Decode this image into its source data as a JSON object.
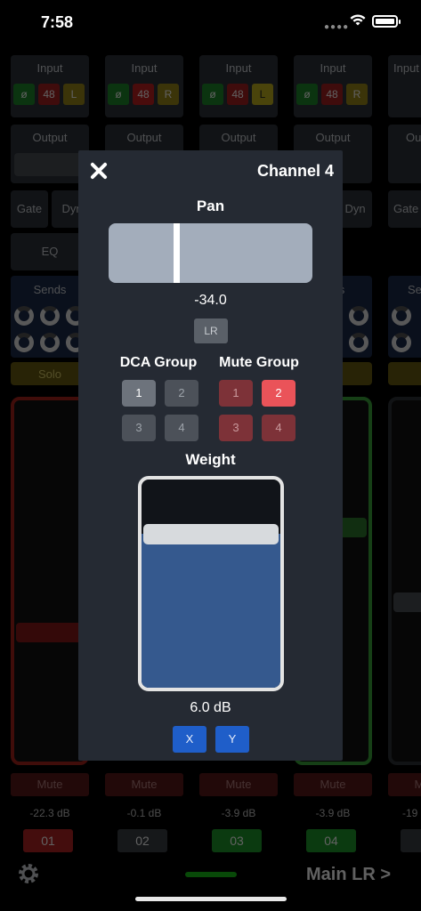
{
  "status_bar": {
    "time": "7:58"
  },
  "mixer": {
    "strips": [
      {
        "input_label": "Input",
        "chip_phase": "ø",
        "chip_48": "48",
        "chip_side": "L",
        "output_label": "Output",
        "gate_label": "Gate",
        "dyn_label": "Dyn",
        "eq_label": "EQ",
        "sends_label": "Sends",
        "solo_label": "Solo",
        "mute_label": "Mute",
        "level": "-22.3 dB",
        "number": "01",
        "number_color": "#b32222"
      },
      {
        "input_label": "Input",
        "chip_phase": "ø",
        "chip_48": "48",
        "chip_side": "R",
        "output_label": "Output",
        "gate_label": "",
        "dyn_label": "",
        "eq_label": "",
        "sends_label": "",
        "solo_label": "",
        "mute_label": "Mute",
        "level": "-0.1 dB",
        "number": "02",
        "number_color": "#3a3f46"
      },
      {
        "input_label": "Input",
        "chip_phase": "ø",
        "chip_48": "48",
        "chip_side": "L",
        "output_label": "Output",
        "gate_label": "",
        "dyn_label": "",
        "eq_label": "",
        "sends_label": "",
        "solo_label": "",
        "mute_label": "Mute",
        "level": "-3.9 dB",
        "number": "03",
        "number_color": "#1f9a2a"
      },
      {
        "input_label": "Input",
        "chip_phase": "ø",
        "chip_48": "48",
        "chip_side": "R",
        "output_label": "Output",
        "gate_label": "",
        "dyn_label": "Dyn",
        "eq_label": "",
        "sends_label": "s",
        "solo_label": "",
        "mute_label": "Mute",
        "level": "-3.9 dB",
        "number": "04",
        "number_color": "#1f9a2a"
      },
      {
        "input_label": "Input",
        "chip_phase": "",
        "chip_48": "",
        "chip_side": "",
        "output_label": "Ou",
        "gate_label": "Gate",
        "dyn_label": "",
        "eq_label": "",
        "sends_label": "Se",
        "solo_label": "",
        "mute_label": "Mute",
        "level": "-19",
        "number": "",
        "number_color": "#3a3f46"
      }
    ],
    "bottom_right_label": "Main LR >"
  },
  "modal": {
    "title": "Channel 4",
    "pan": {
      "title": "Pan",
      "value_text": "-34.0",
      "position_fraction": 0.33,
      "lr_label": "LR"
    },
    "dca_group": {
      "title": "DCA Group",
      "buttons": [
        "1",
        "2",
        "3",
        "4"
      ],
      "active": [
        true,
        false,
        false,
        false
      ]
    },
    "mute_group": {
      "title": "Mute Group",
      "buttons": [
        "1",
        "2",
        "3",
        "4"
      ],
      "active": [
        false,
        true,
        false,
        false
      ]
    },
    "weight": {
      "title": "Weight",
      "value_text": "6.0 dB",
      "fill_fraction": 0.74,
      "x_label": "X",
      "y_label": "Y"
    }
  },
  "colors": {
    "accent_blue": "#1f5ec9",
    "mute_red": "#ea5359",
    "modal_bg": "#252a33"
  }
}
